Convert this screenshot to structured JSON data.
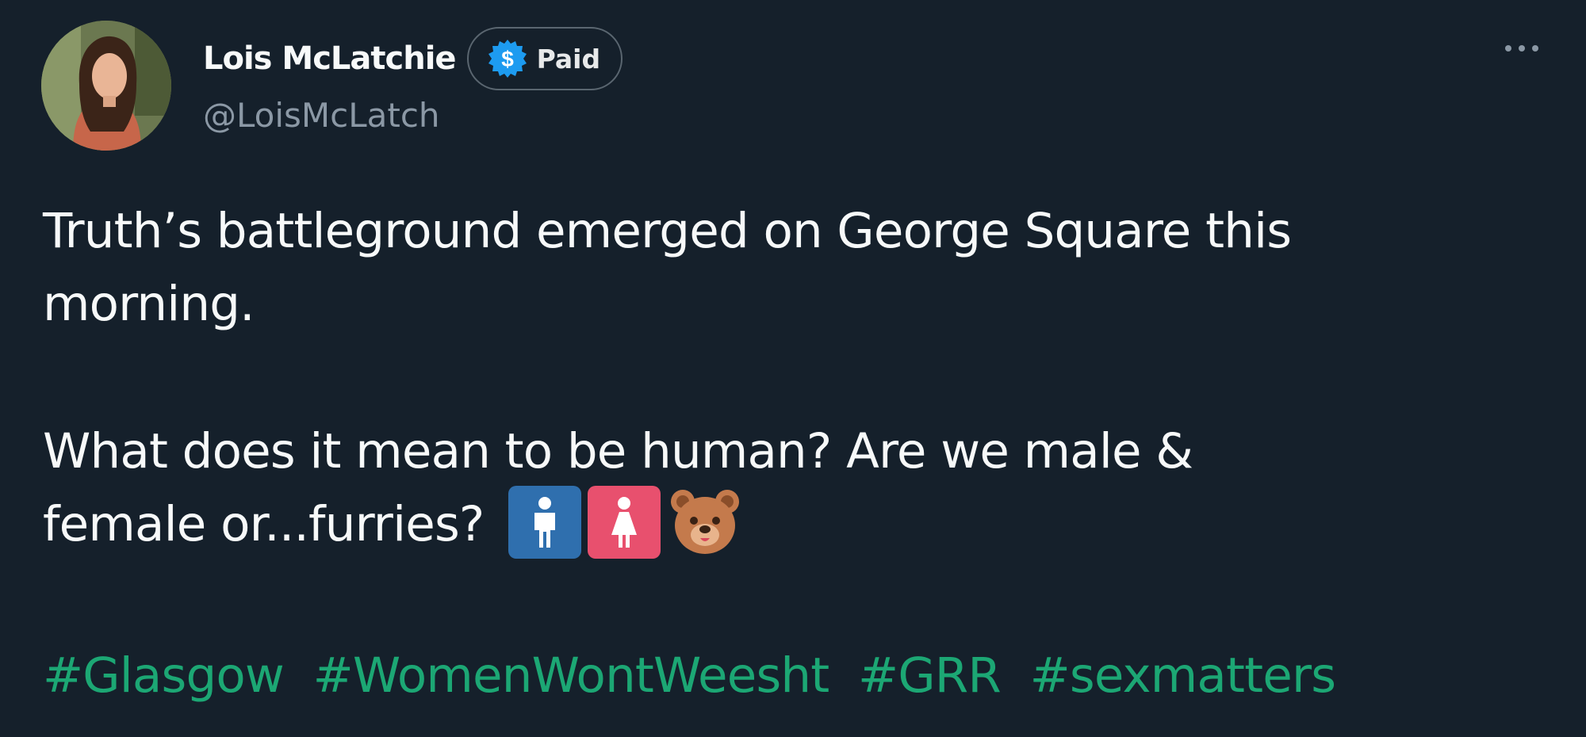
{
  "author": {
    "display_name": "Lois McLatchie",
    "badge_label": "Paid",
    "handle": "@LoisMcLatch"
  },
  "tweet": {
    "line1": "Truth’s battleground emerged on George Square this",
    "line2": "morning.",
    "line3": "What does it mean to be human? Are we male &",
    "line4": "female or...furries?",
    "emojis": [
      "mens-room-icon",
      "womens-room-icon",
      "bear-face-icon"
    ],
    "hashtags": [
      "#Glasgow",
      "#WomenWontWeesht",
      "#GRR",
      "#sexmatters"
    ]
  },
  "colors": {
    "background": "#15202b",
    "hashtag": "#1ca774",
    "muted": "#8b98a5",
    "badge_icon": "#1d9bf0"
  },
  "icons": {
    "more": "more-horizontal-icon",
    "badge": "dollar-badge-icon"
  }
}
